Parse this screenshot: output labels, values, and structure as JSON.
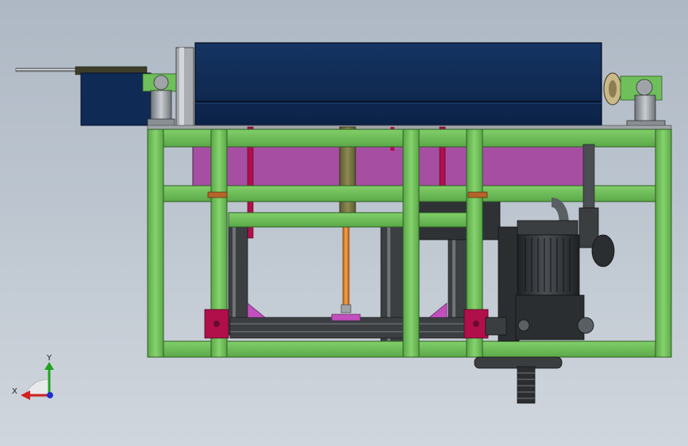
{
  "viewport": {
    "background_top": "#aeb8c4",
    "background_bottom": "#d0d6dd"
  },
  "colors": {
    "frame_green": "#6fbf5a",
    "frame_green_dark": "#3d7a30",
    "hood_blue": "#0f2a52",
    "hood_blue_light": "#1d3f6e",
    "tank_magenta": "#a64fa2",
    "accent_crimson": "#b00f4a",
    "motor_dark": "#2b2e31",
    "rod_orange": "#e07a1d"
  },
  "triad": {
    "x_label": "X",
    "y_label": "Y",
    "x_color": "#d21f1f",
    "y_color": "#1fa31f",
    "z_color": "#1f2fd2"
  }
}
